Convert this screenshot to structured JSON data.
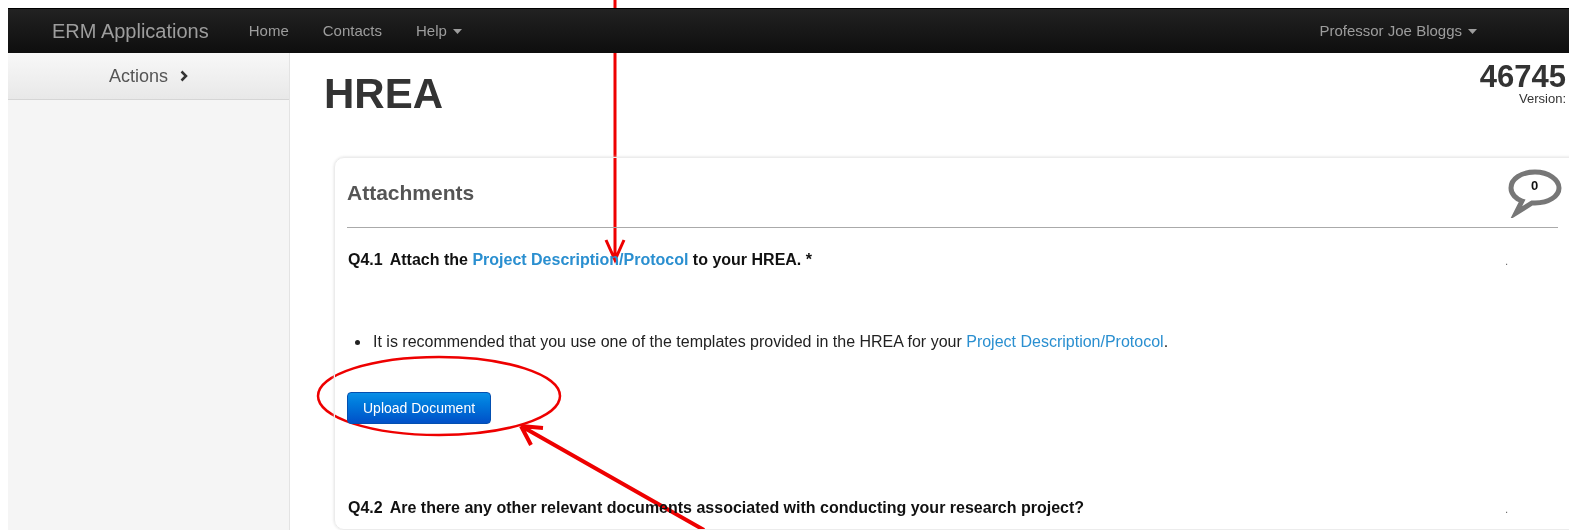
{
  "navbar": {
    "brand": "ERM Applications",
    "items": [
      {
        "label": "Home",
        "dropdown": false
      },
      {
        "label": "Contacts",
        "dropdown": false
      },
      {
        "label": "Help",
        "dropdown": true
      }
    ],
    "user": "Professor Joe Bloggs"
  },
  "sidebar": {
    "header": "Actions"
  },
  "page": {
    "title": "HREA",
    "id": "46745",
    "version_label": "Version:"
  },
  "section": {
    "title": "Attachments",
    "comment_count": "0",
    "questions": [
      {
        "number": "Q4.1",
        "text_before": "Attach the",
        "link": "Project Description/Protocol",
        "text_after": "to your HREA. *",
        "marker": ".",
        "bullets": [
          {
            "text_before": "It is recommended that you use one of the templates provided in the HREA for your",
            "link": "Project Description/Protocol",
            "text_after": "."
          }
        ],
        "button": "Upload Document"
      },
      {
        "number": "Q4.2",
        "text_before": "Are there any other relevant documents associated with conducting your research project?",
        "marker": "."
      }
    ]
  }
}
